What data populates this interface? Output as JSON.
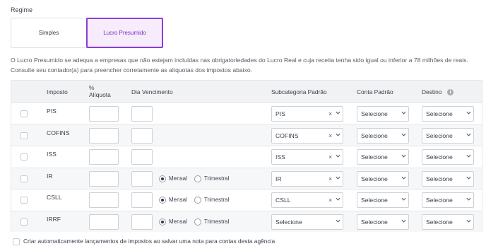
{
  "regime": {
    "label": "Regime",
    "options": [
      "Simples",
      "Lucro Presumido"
    ],
    "selected": "Lucro Presumido"
  },
  "description": "O Lucro Presumido se adequa a empresas que não estejam incluídas nas obrigatoriedades do Lucro Real e cuja receita tenha sido igual ou inferior a 78 milhões de reais. Consulte seu contador(a) para preencher corretamente as alíquotas dos impostos abaixo.",
  "table": {
    "headers": {
      "imposto": "Imposto",
      "aliquota": "% Alíquota",
      "dia": "Dia Vencimento",
      "subcategoria": "Subcategoria Padrão",
      "conta": "Conta Padrão",
      "destino": "Destino"
    },
    "radio_labels": {
      "mensal": "Mensal",
      "trimestral": "Trimestral"
    },
    "rows": [
      {
        "imposto": "PIS",
        "subcategoria": "PIS",
        "conta": "Selecione",
        "destino": "Selecione"
      },
      {
        "imposto": "COFINS",
        "subcategoria": "COFINS",
        "conta": "Selecione",
        "destino": "Selecione"
      },
      {
        "imposto": "ISS",
        "subcategoria": "ISS",
        "conta": "Selecione",
        "destino": "Selecione"
      },
      {
        "imposto": "IR",
        "periodicidade": "Mensal",
        "subcategoria": "IR",
        "conta": "Selecione",
        "destino": "Selecione"
      },
      {
        "imposto": "CSLL",
        "periodicidade": "Mensal",
        "subcategoria": "CSLL",
        "conta": "Selecione",
        "destino": "Selecione"
      },
      {
        "imposto": "IRRF",
        "periodicidade": "Mensal",
        "subcategoria": "Selecione",
        "conta": "Selecione",
        "destino": "Selecione"
      }
    ]
  },
  "footer": {
    "auto_launch_label": "Criar automaticamente lançamentos de impostos ao salvar uma nota para contas desta agência"
  },
  "icons": {
    "clear": "close-icon",
    "dropdown": "chevron-down-icon",
    "info": "info-icon"
  },
  "colors": {
    "accent": "#8b3dd6",
    "accent_bg": "#f7ecfb",
    "header_bg": "#f1f2f4"
  }
}
